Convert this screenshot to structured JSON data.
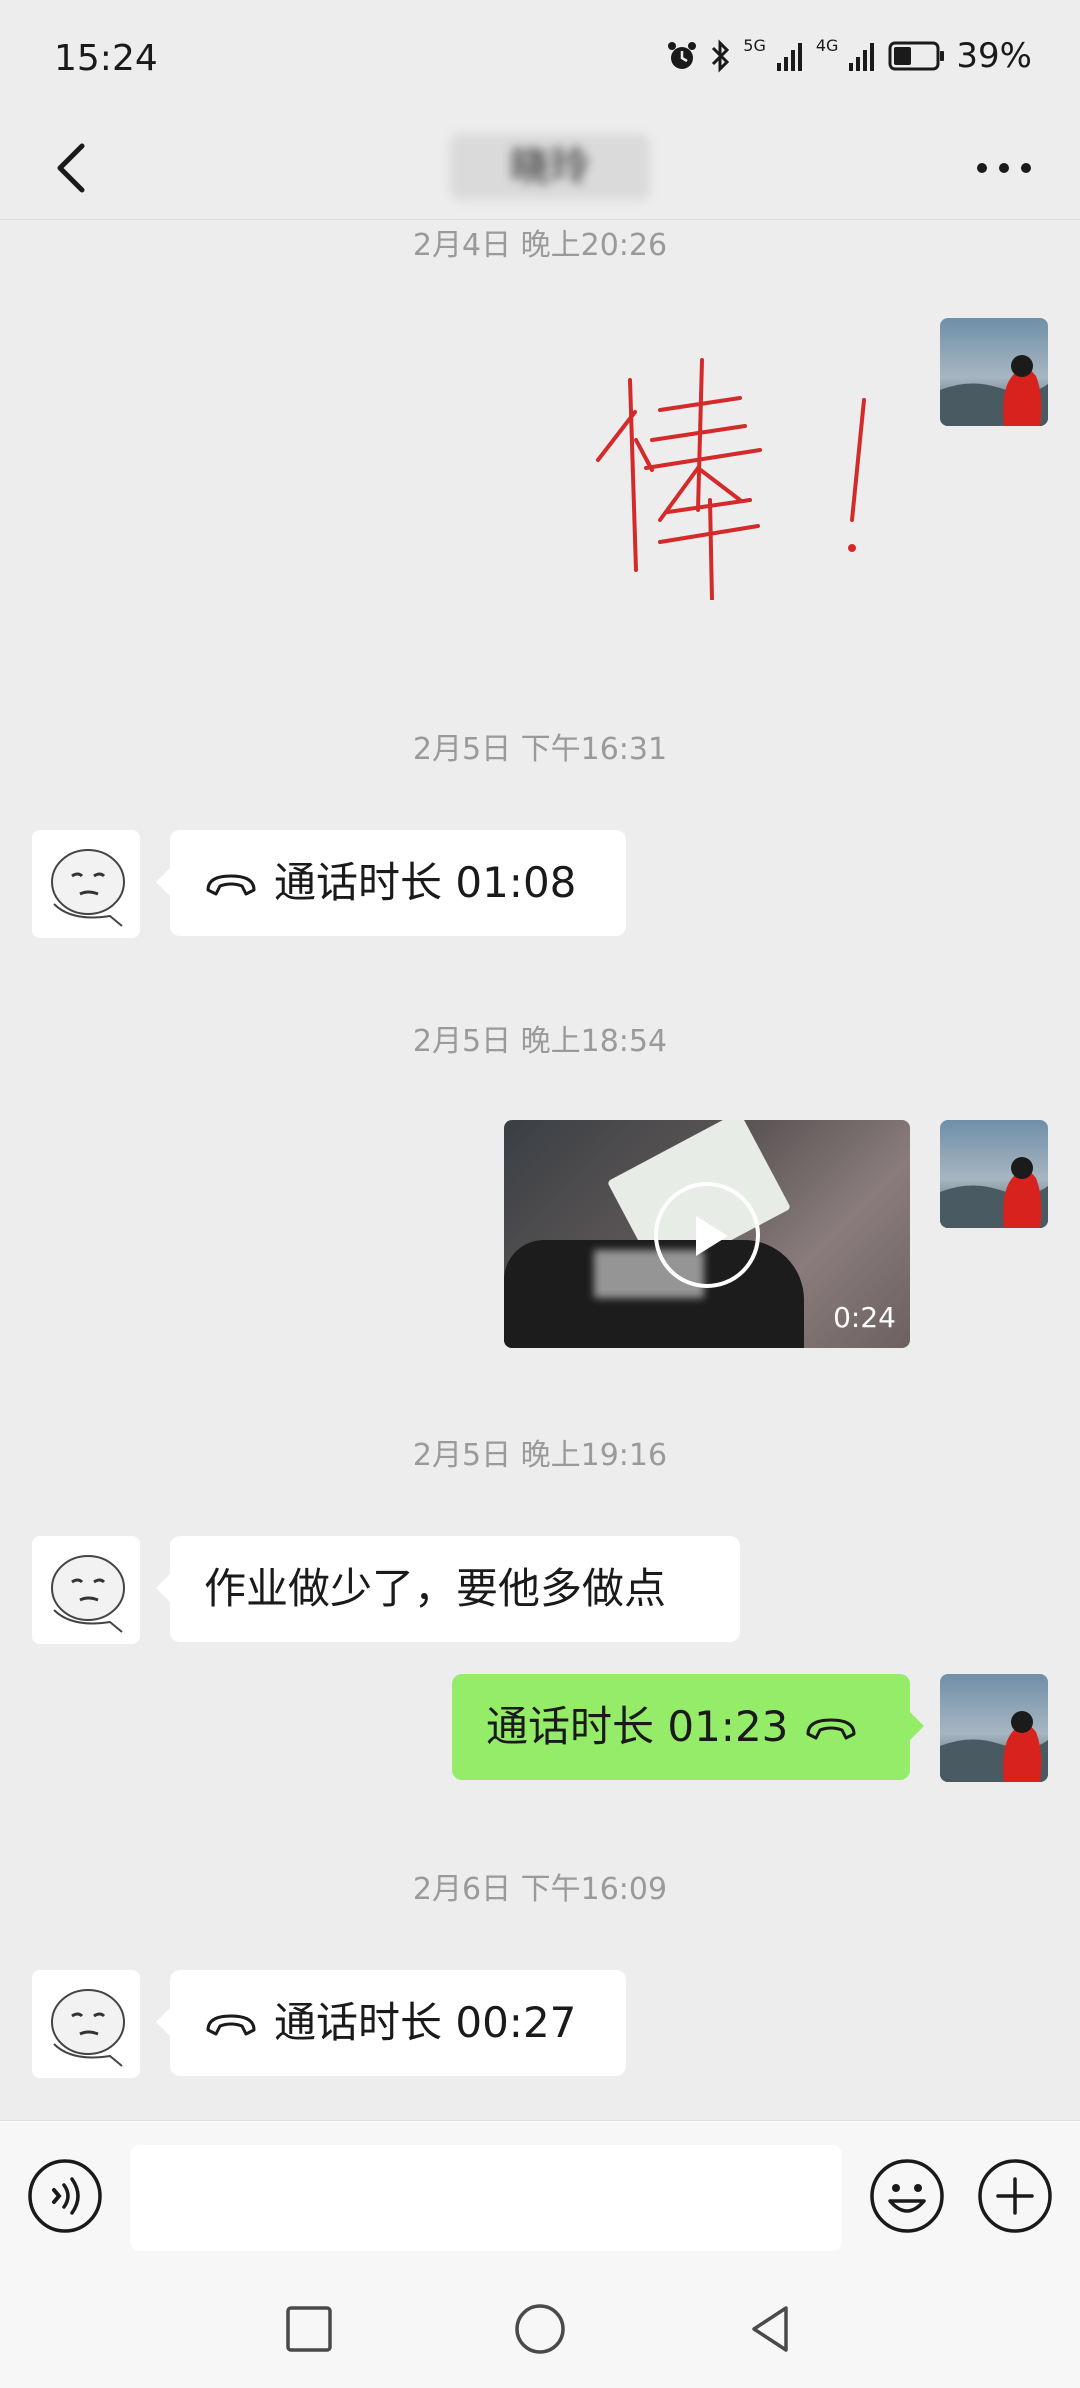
{
  "status_bar": {
    "time": "15:24",
    "network_1": "5G",
    "network_2": "4G",
    "battery": "39%"
  },
  "header": {
    "title": "晓玲"
  },
  "messages": [
    {
      "type": "timestamp",
      "text": "2月4日 晚上20:26"
    },
    {
      "type": "sticker",
      "side": "right",
      "sticker_text": "棒!"
    },
    {
      "type": "timestamp",
      "text": "2月5日 下午16:31"
    },
    {
      "type": "call",
      "side": "left",
      "text": "通话时长 01:08"
    },
    {
      "type": "timestamp",
      "text": "2月5日 晚上18:54"
    },
    {
      "type": "video",
      "side": "right",
      "duration": "0:24"
    },
    {
      "type": "timestamp",
      "text": "2月5日 晚上19:16"
    },
    {
      "type": "text",
      "side": "left",
      "text": "作业做少了，要他多做点"
    },
    {
      "type": "call",
      "side": "right",
      "text": "通话时长 01:23"
    },
    {
      "type": "timestamp",
      "text": "2月6日 下午16:09"
    },
    {
      "type": "call",
      "side": "left",
      "text": "通话时长 00:27"
    }
  ],
  "input_bar": {
    "value": "",
    "icons": [
      "voice-icon",
      "emoji-icon",
      "plus-icon"
    ]
  },
  "system_nav": {
    "icons": [
      "recent-apps-icon",
      "home-icon",
      "back-triangle-icon"
    ]
  },
  "colors": {
    "background": "#ededed",
    "sent_bubble": "#95ec69",
    "received_bubble": "#ffffff",
    "timestamp": "#9a9a9a",
    "sticker_red": "#d42a2a"
  }
}
